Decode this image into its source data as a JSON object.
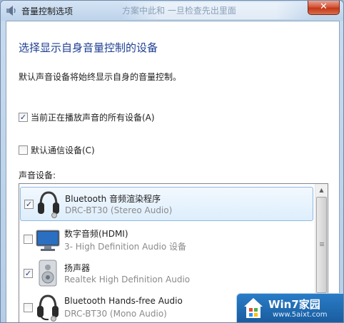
{
  "window": {
    "title": "音量控制选项",
    "background_title": "方案中此和 一旦检查先出里面",
    "close_label": "✕"
  },
  "content": {
    "heading": "选择显示自身音量控制的设备",
    "description": "默认声音设备将始终显示自身的音量控制。",
    "options": [
      {
        "label": "当前正在播放声音的所有设备(A)",
        "checked": true
      },
      {
        "label": "默认通信设备(C)",
        "checked": false
      }
    ],
    "devices_label": "声音设备:"
  },
  "devices": [
    {
      "name": "Bluetooth 音频渲染程序",
      "sub": "DRC-BT30 (Stereo Audio)",
      "checked": true,
      "icon": "headset-icon",
      "selected": true
    },
    {
      "name": "数字音频(HDMI)",
      "sub": "3- High Definition Audio 设备",
      "checked": false,
      "icon": "monitor-icon",
      "selected": false
    },
    {
      "name": "扬声器",
      "sub": "Realtek High Definition Audio",
      "checked": true,
      "icon": "speaker-icon",
      "selected": false
    },
    {
      "name": "Bluetooth Hands-free Audio",
      "sub": "DRC-BT30 (Mono Audio)",
      "checked": false,
      "icon": "headset-icon",
      "selected": false
    }
  ],
  "watermark": {
    "title": "Win7家园",
    "url": "www.5aixt.com"
  },
  "colors": {
    "heading": "#1e3f91",
    "close_button": "#c43716",
    "selection": "#ddeefc"
  }
}
